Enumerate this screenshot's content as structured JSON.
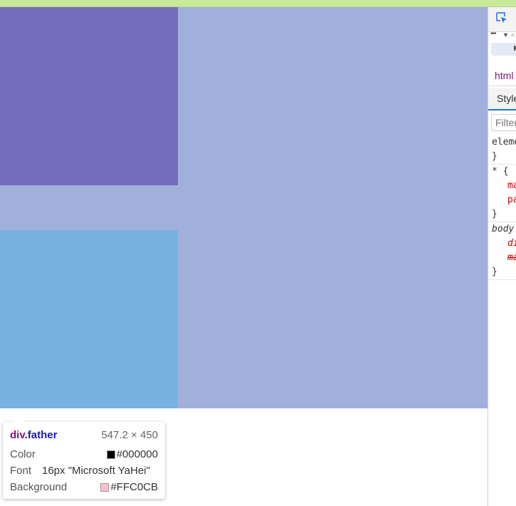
{
  "tooltip": {
    "tag": "div",
    "class_name": ".father",
    "size": "547.2 × 450",
    "color_label": "Color",
    "color_value": "#000000",
    "color_swatch": "#000000",
    "font_label": "Font",
    "font_value": "16px \"Microsoft YaHei\"",
    "background_label": "Background",
    "background_value": "#FFC0CB",
    "background_swatch": "#FFC0CB"
  },
  "devtools": {
    "inspect_icon": "element-picker-icon",
    "more_icon_glyph": "•••",
    "dropdown_glyph": "▼",
    "back_glyph": "<",
    "play_glyph": "▶",
    "breadcrumb": "html",
    "styles_tab": "Styles",
    "filter_placeholder": "Filter",
    "rules": [
      {
        "lines": [
          "element.style {",
          "}"
        ]
      },
      {
        "lines": [
          "* {",
          "margin",
          "padding",
          "}"
        ]
      },
      {
        "lines": [
          "body {",
          "display",
          "margin",
          "}"
        ]
      }
    ]
  },
  "colors": {
    "top_strip": "#c9ea9a",
    "father_overlay": "#a1b0da",
    "child_a": "#746dbc",
    "child_b": "#77b2e0",
    "accent": "#1a73e8"
  }
}
